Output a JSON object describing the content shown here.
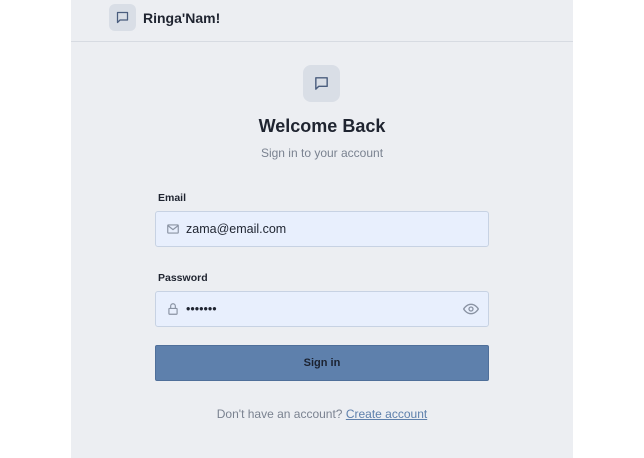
{
  "app": {
    "brand_name": "Ringa'Nam!",
    "logo_icon": "chat-bubble-icon"
  },
  "login": {
    "title": "Welcome Back",
    "subtitle": "Sign in to your account",
    "email": {
      "label": "Email",
      "value": "zama@email.com",
      "icon": "mail-icon"
    },
    "password": {
      "label": "Password",
      "value": "•••••••",
      "icon": "lock-icon",
      "toggle_icon": "eye-icon"
    },
    "submit_label": "Sign in",
    "footer": {
      "prompt": "Don't have an account?",
      "link_label": "Create account"
    }
  },
  "colors": {
    "background": "#eceef2",
    "input_bg": "#e8effd",
    "button": "#5e80ac",
    "link": "#5e80ac"
  }
}
